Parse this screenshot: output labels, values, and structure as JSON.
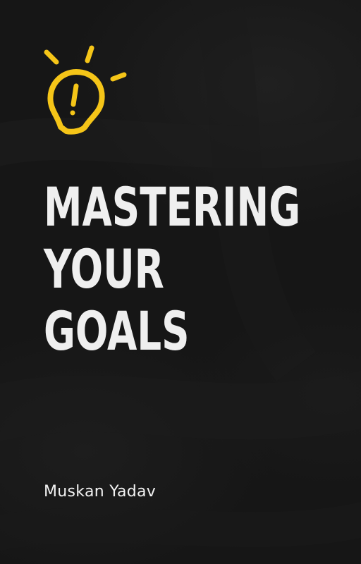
{
  "cover": {
    "title_lines": [
      "MASTERING",
      "YOUR",
      "GOALS"
    ],
    "author": "Muskan Yadav",
    "icon": "lightbulb-exclamation-icon"
  },
  "colors": {
    "background": "#161616",
    "title": "#efefef",
    "accent": "#f5c518"
  }
}
